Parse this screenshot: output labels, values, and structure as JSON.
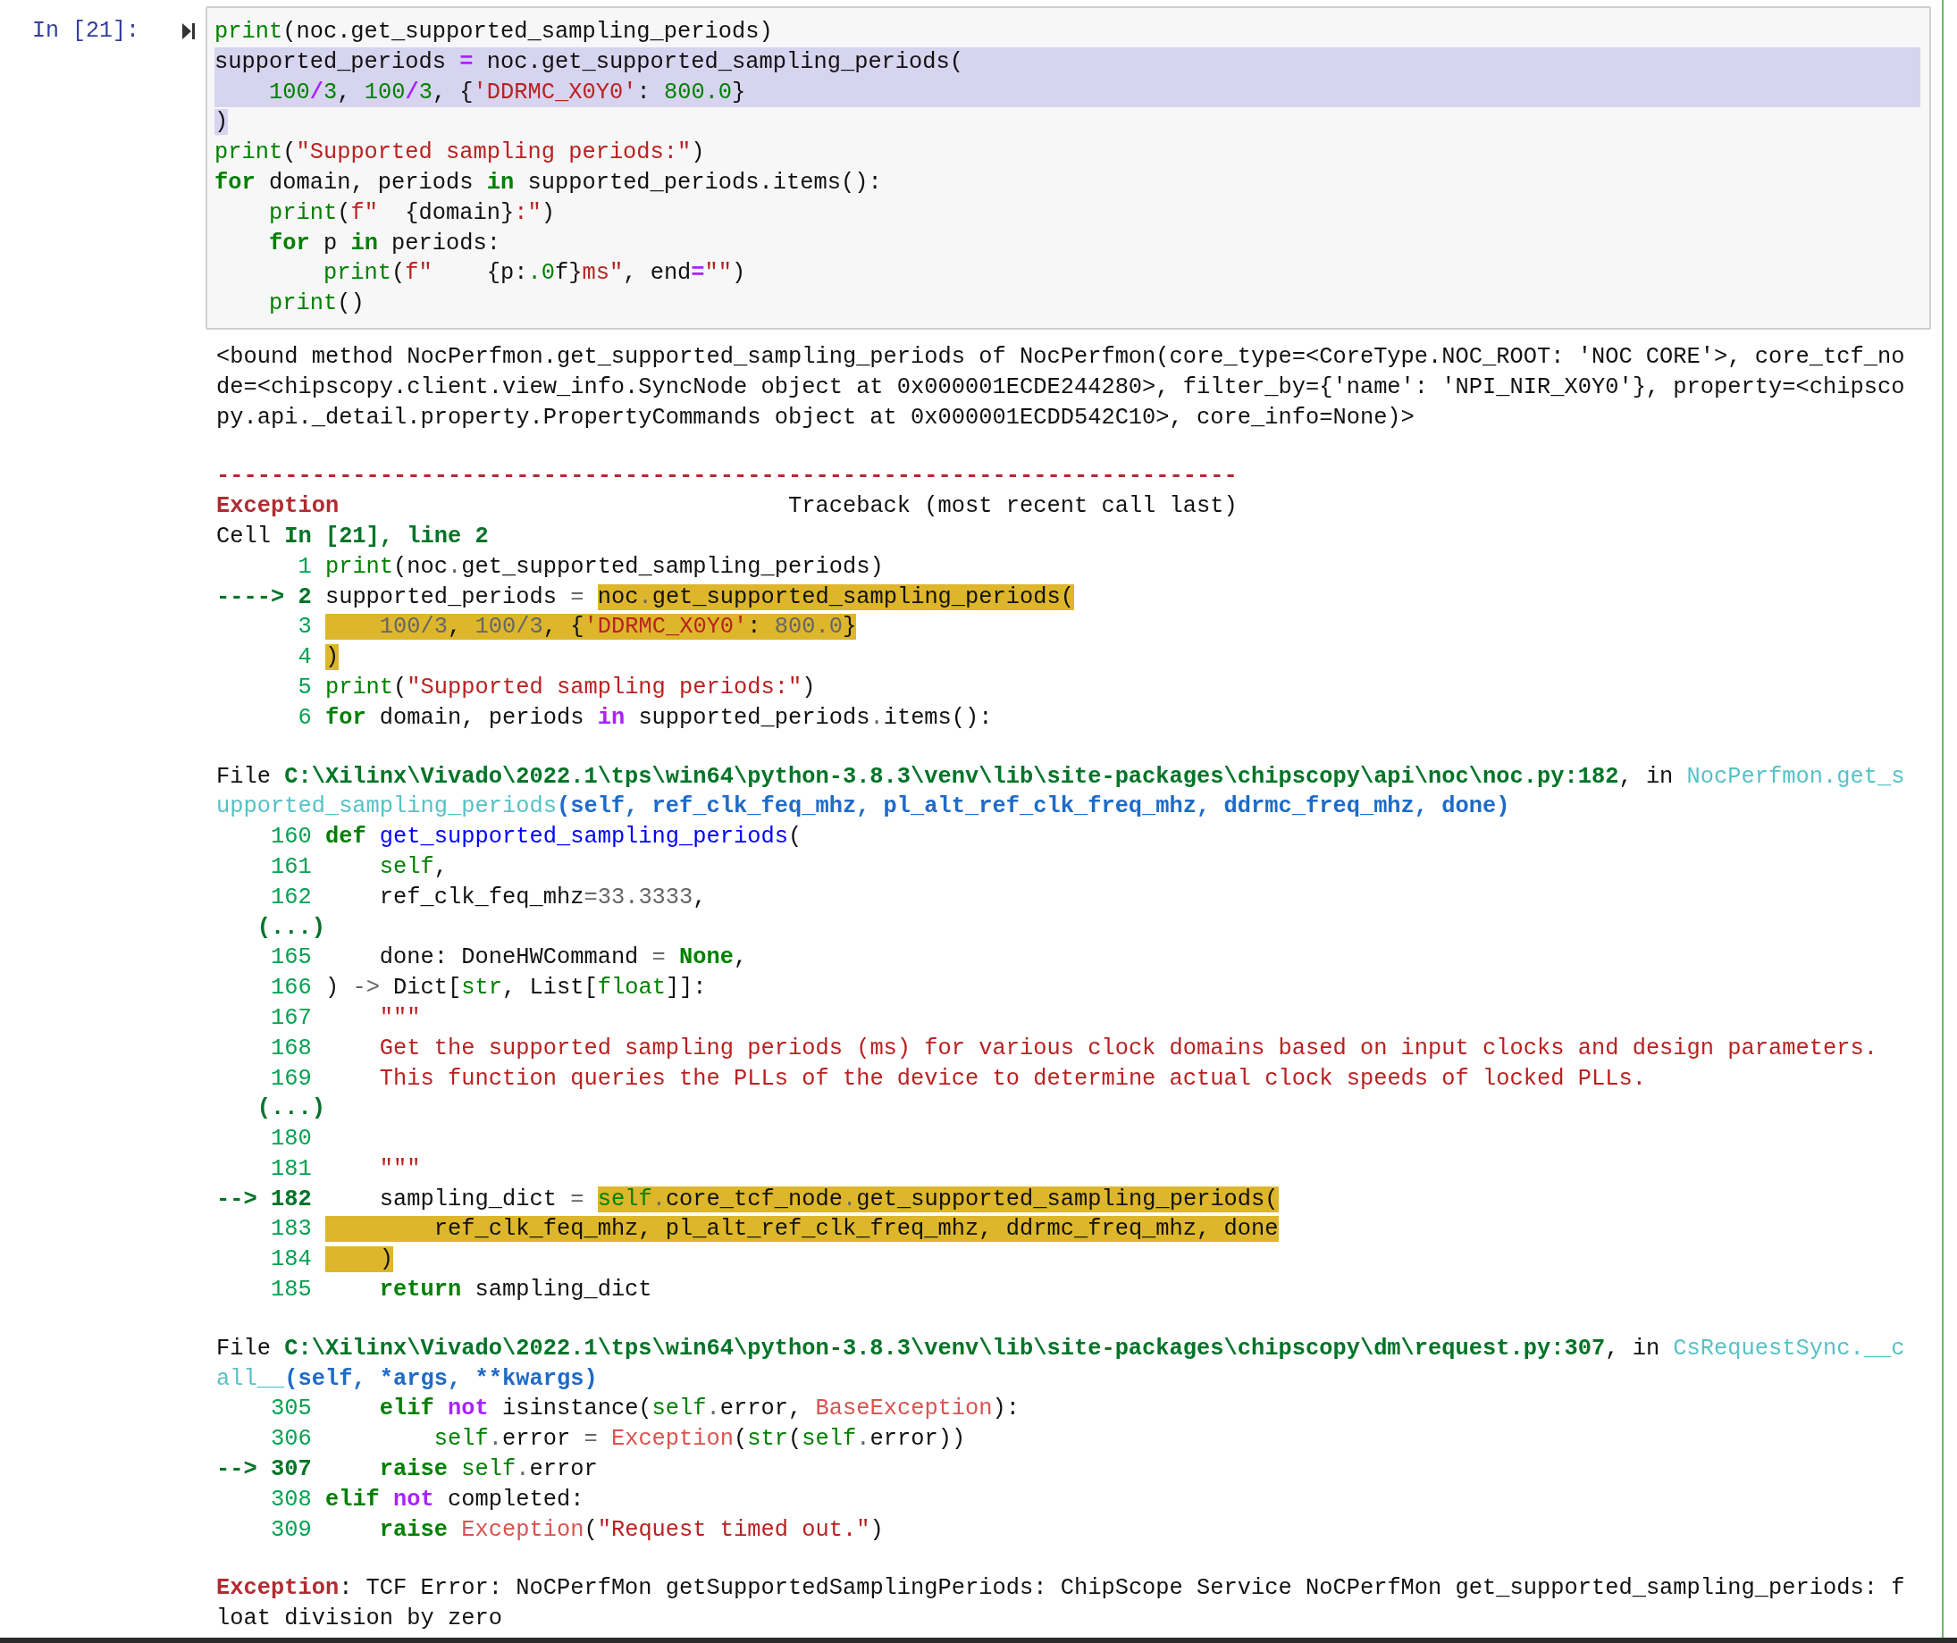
{
  "prompt": "In [21]:",
  "code": {
    "lines": [
      {
        "selected": false,
        "tokens": [
          {
            "text": "print",
            "kind": "builtin"
          },
          {
            "text": "(noc.get_supported_sampling_periods)",
            "kind": "plain"
          }
        ]
      },
      {
        "selected": true,
        "tokens": [
          {
            "text": "supported_periods ",
            "kind": "plain"
          },
          {
            "text": "=",
            "kind": "op"
          },
          {
            "text": " noc.get_supported_sampling_periods(",
            "kind": "plain"
          }
        ]
      },
      {
        "selected": true,
        "tokens": [
          {
            "text": "    100",
            "kind": "num"
          },
          {
            "text": "/",
            "kind": "op"
          },
          {
            "text": "3",
            "kind": "num"
          },
          {
            "text": ", ",
            "kind": "plain"
          },
          {
            "text": "100",
            "kind": "num"
          },
          {
            "text": "/",
            "kind": "op"
          },
          {
            "text": "3",
            "kind": "num"
          },
          {
            "text": ", {",
            "kind": "plain"
          },
          {
            "text": "'DDRMC_X0Y0'",
            "kind": "str"
          },
          {
            "text": ": ",
            "kind": "plain"
          },
          {
            "text": "800.0",
            "kind": "num"
          },
          {
            "text": "}",
            "kind": "plain"
          }
        ]
      },
      {
        "selected": false,
        "tokens": [
          {
            "text": ")",
            "kind": "plain",
            "highlighted": true
          }
        ]
      },
      {
        "selected": false,
        "tokens": [
          {
            "text": "print",
            "kind": "builtin"
          },
          {
            "text": "(",
            "kind": "plain"
          },
          {
            "text": "\"Supported sampling periods:\"",
            "kind": "str"
          },
          {
            "text": ")",
            "kind": "plain"
          }
        ]
      },
      {
        "selected": false,
        "tokens": [
          {
            "text": "for",
            "kind": "kw"
          },
          {
            "text": " domain, periods ",
            "kind": "plain"
          },
          {
            "text": "in",
            "kind": "kw"
          },
          {
            "text": " supported_periods.items():",
            "kind": "plain"
          }
        ]
      },
      {
        "selected": false,
        "tokens": [
          {
            "text": "    print",
            "kind": "builtin"
          },
          {
            "text": "(",
            "kind": "plain"
          },
          {
            "text": "f\"  ",
            "kind": "str"
          },
          {
            "text": "{domain}",
            "kind": "plain"
          },
          {
            "text": ":\"",
            "kind": "str"
          },
          {
            "text": ")",
            "kind": "plain"
          }
        ]
      },
      {
        "selected": false,
        "tokens": [
          {
            "text": "    for",
            "kind": "kw"
          },
          {
            "text": " p ",
            "kind": "plain"
          },
          {
            "text": "in",
            "kind": "kw"
          },
          {
            "text": " periods:",
            "kind": "plain"
          }
        ]
      },
      {
        "selected": false,
        "tokens": [
          {
            "text": "        print",
            "kind": "builtin"
          },
          {
            "text": "(",
            "kind": "plain"
          },
          {
            "text": "f\"    ",
            "kind": "str"
          },
          {
            "text": "{p:",
            "kind": "plain"
          },
          {
            "text": ".0",
            "kind": "num"
          },
          {
            "text": "f}",
            "kind": "plain"
          },
          {
            "text": "ms\"",
            "kind": "str"
          },
          {
            "text": ", end",
            "kind": "plain"
          },
          {
            "text": "=",
            "kind": "op"
          },
          {
            "text": "\"\"",
            "kind": "str"
          },
          {
            "text": ")",
            "kind": "plain"
          }
        ]
      },
      {
        "selected": false,
        "tokens": [
          {
            "text": "    print",
            "kind": "builtin"
          },
          {
            "text": "()",
            "kind": "plain"
          }
        ]
      }
    ]
  },
  "output": {
    "blocks": [
      {
        "lines": [
          {
            "tokens": [
              {
                "text": "<bound method NocPerfmon.get_supported_sampling_periods of NocPerfmon(core_type=<CoreType.NOC_ROOT: 'NOC CORE'>, core_tcf_no",
                "kind": "plain"
              }
            ]
          },
          {
            "tokens": [
              {
                "text": "de=<chipscopy.client.view_info.SyncNode object at 0x000001ECDE244280>, filter_by={'name': 'NPI_NIR_X0Y0'}, property=<chipsco",
                "kind": "plain"
              }
            ]
          },
          {
            "tokens": [
              {
                "text": "py.api._detail.property.PropertyCommands object at 0x000001ECDD542C10>, core_info=None)>",
                "kind": "plain"
              }
            ]
          }
        ]
      },
      {
        "lines": [
          {
            "tokens": [
              {
                "text": "---------------------------------------------------------------------------",
                "kind": "ename"
              }
            ]
          },
          {
            "tokens": [
              {
                "text": "Exception",
                "kind": "ename"
              },
              {
                "text": "                                 Traceback (most recent call last)",
                "kind": "plain"
              }
            ]
          },
          {
            "tokens": [
              {
                "text": "Cell ",
                "kind": "plain"
              },
              {
                "text": "In [21], line 2",
                "kind": "path"
              }
            ]
          },
          {
            "tokens": [
              {
                "text": "      1 ",
                "kind": "lineno"
              },
              {
                "text": "print",
                "kind": "builtin"
              },
              {
                "text": "(noc",
                "kind": "plain"
              },
              {
                "text": ".",
                "kind": "dim"
              },
              {
                "text": "get_supported_sampling_periods)",
                "kind": "plain"
              }
            ]
          },
          {
            "tokens": [
              {
                "text": "----> 2",
                "kind": "arrow",
                "highlighted": false
              },
              {
                "text": " supported_periods ",
                "kind": "plain",
                "highlighted": false
              },
              {
                "text": "= ",
                "kind": "dim",
                "highlighted": false
              },
              {
                "text": "noc",
                "kind": "plain",
                "highlighted": true
              },
              {
                "text": ".",
                "kind": "dim",
                "highlighted": true
              },
              {
                "text": "get_supported_sampling_periods(",
                "kind": "plain",
                "highlighted": true
              }
            ]
          },
          {
            "tokens": [
              {
                "text": "      3 ",
                "kind": "lineno",
                "highlighted": false
              },
              {
                "text": "    100",
                "kind": "numdim",
                "highlighted": true
              },
              {
                "text": "/",
                "kind": "dim",
                "highlighted": true
              },
              {
                "text": "3",
                "kind": "numdim",
                "highlighted": true
              },
              {
                "text": ", ",
                "kind": "plain",
                "highlighted": true
              },
              {
                "text": "100",
                "kind": "numdim",
                "highlighted": true
              },
              {
                "text": "/",
                "kind": "dim",
                "highlighted": true
              },
              {
                "text": "3",
                "kind": "numdim",
                "highlighted": true
              },
              {
                "text": ", {",
                "kind": "plain",
                "highlighted": true
              },
              {
                "text": "'DDRMC_X0Y0'",
                "kind": "str",
                "highlighted": true
              },
              {
                "text": ": ",
                "kind": "plain",
                "highlighted": true
              },
              {
                "text": "800.0",
                "kind": "numdim",
                "highlighted": true
              },
              {
                "text": "}",
                "kind": "plain",
                "highlighted": true
              }
            ]
          },
          {
            "tokens": [
              {
                "text": "      4 ",
                "kind": "lineno",
                "highlighted": false
              },
              {
                "text": ")",
                "kind": "plain",
                "highlighted": true
              }
            ]
          },
          {
            "tokens": [
              {
                "text": "      5 ",
                "kind": "lineno"
              },
              {
                "text": "print",
                "kind": "builtin"
              },
              {
                "text": "(",
                "kind": "plain"
              },
              {
                "text": "\"Supported sampling periods:\"",
                "kind": "str"
              },
              {
                "text": ")",
                "kind": "plain"
              }
            ]
          },
          {
            "tokens": [
              {
                "text": "      6 ",
                "kind": "lineno"
              },
              {
                "text": "for",
                "kind": "kw"
              },
              {
                "text": " domain, periods ",
                "kind": "plain"
              },
              {
                "text": "in",
                "kind": "opword"
              },
              {
                "text": " supported_periods",
                "kind": "plain"
              },
              {
                "text": ".",
                "kind": "dim"
              },
              {
                "text": "items():",
                "kind": "plain"
              }
            ]
          }
        ]
      },
      {
        "lines": [
          {
            "tokens": [
              {
                "text": "File ",
                "kind": "plain"
              },
              {
                "text": "C:\\Xilinx\\Vivado\\2022.1\\tps\\win64\\python-3.8.3\\venv\\lib\\site-packages\\chipscopy\\api\\noc\\noc.py:182",
                "kind": "path"
              },
              {
                "text": ", in ",
                "kind": "plain"
              },
              {
                "text": "NocPerfmon.get_s",
                "kind": "cyan"
              }
            ]
          },
          {
            "tokens": [
              {
                "text": "upported_sampling_periods",
                "kind": "cyan"
              },
              {
                "text": "(self, ref_clk_feq_mhz, pl_alt_ref_clk_freq_mhz, ddrmc_freq_mhz, done)",
                "kind": "blue"
              }
            ]
          },
          {
            "tokens": [
              {
                "text": "    160 ",
                "kind": "lineno"
              },
              {
                "text": "def ",
                "kind": "kw"
              },
              {
                "text": "get_supported_sampling_periods",
                "kind": "fname"
              },
              {
                "text": "(",
                "kind": "plain"
              }
            ]
          },
          {
            "tokens": [
              {
                "text": "    161 ",
                "kind": "lineno"
              },
              {
                "text": "    self",
                "kind": "builtin"
              },
              {
                "text": ",",
                "kind": "plain"
              }
            ]
          },
          {
            "tokens": [
              {
                "text": "    162 ",
                "kind": "lineno"
              },
              {
                "text": "    ref_clk_feq_mhz",
                "kind": "plain"
              },
              {
                "text": "=",
                "kind": "dim"
              },
              {
                "text": "33.3333",
                "kind": "numdim"
              },
              {
                "text": ",",
                "kind": "plain"
              }
            ]
          },
          {
            "tokens": [
              {
                "text": "   (...)",
                "kind": "path"
              }
            ]
          },
          {
            "tokens": [
              {
                "text": "    165 ",
                "kind": "lineno"
              },
              {
                "text": "    done: DoneHWCommand ",
                "kind": "plain"
              },
              {
                "text": "= ",
                "kind": "dim"
              },
              {
                "text": "None",
                "kind": "kw"
              },
              {
                "text": ",",
                "kind": "plain"
              }
            ]
          },
          {
            "tokens": [
              {
                "text": "    166 ",
                "kind": "lineno"
              },
              {
                "text": ") ",
                "kind": "plain"
              },
              {
                "text": "->",
                "kind": "dim"
              },
              {
                "text": " Dict[",
                "kind": "plain"
              },
              {
                "text": "str",
                "kind": "builtin"
              },
              {
                "text": ", List[",
                "kind": "plain"
              },
              {
                "text": "float",
                "kind": "builtin"
              },
              {
                "text": "]]:",
                "kind": "plain"
              }
            ]
          },
          {
            "tokens": [
              {
                "text": "    167 ",
                "kind": "lineno"
              },
              {
                "text": "    \"\"\"",
                "kind": "str"
              }
            ]
          },
          {
            "tokens": [
              {
                "text": "    168 ",
                "kind": "lineno"
              },
              {
                "text": "    Get the supported sampling periods (ms) for various clock domains based on input clocks and design parameters.",
                "kind": "str"
              }
            ]
          },
          {
            "tokens": [
              {
                "text": "    169 ",
                "kind": "lineno"
              },
              {
                "text": "    This function queries the PLLs of the device to determine actual clock speeds of locked PLLs.",
                "kind": "str"
              }
            ]
          },
          {
            "tokens": [
              {
                "text": "   (...)",
                "kind": "path"
              }
            ]
          },
          {
            "tokens": [
              {
                "text": "    180",
                "kind": "lineno"
              }
            ]
          },
          {
            "tokens": [
              {
                "text": "    181 ",
                "kind": "lineno"
              },
              {
                "text": "    \"\"\"",
                "kind": "str"
              }
            ]
          },
          {
            "tokens": [
              {
                "text": "--> 182",
                "kind": "arrow",
                "highlighted": false
              },
              {
                "text": "     sampling_dict ",
                "kind": "plain",
                "highlighted": false
              },
              {
                "text": "= ",
                "kind": "dim",
                "highlighted": false
              },
              {
                "text": "self",
                "kind": "builtin",
                "highlighted": true
              },
              {
                "text": ".",
                "kind": "dim",
                "highlighted": true
              },
              {
                "text": "core_tcf_node",
                "kind": "plain",
                "highlighted": true
              },
              {
                "text": ".",
                "kind": "dim",
                "highlighted": true
              },
              {
                "text": "get_supported_sampling_periods(",
                "kind": "plain",
                "highlighted": true
              }
            ]
          },
          {
            "tokens": [
              {
                "text": "    183 ",
                "kind": "lineno",
                "highlighted": false
              },
              {
                "text": "        ref_clk_feq_mhz, pl_alt_ref_clk_freq_mhz, ddrmc_freq_mhz, done",
                "kind": "plain",
                "highlighted": true
              }
            ]
          },
          {
            "tokens": [
              {
                "text": "    184 ",
                "kind": "lineno",
                "highlighted": false
              },
              {
                "text": "    )",
                "kind": "plain",
                "highlighted": true
              }
            ]
          },
          {
            "tokens": [
              {
                "text": "    185 ",
                "kind": "lineno"
              },
              {
                "text": "    return",
                "kind": "kw"
              },
              {
                "text": " sampling_dict",
                "kind": "plain"
              }
            ]
          }
        ]
      },
      {
        "lines": [
          {
            "tokens": [
              {
                "text": "File ",
                "kind": "plain"
              },
              {
                "text": "C:\\Xilinx\\Vivado\\2022.1\\tps\\win64\\python-3.8.3\\venv\\lib\\site-packages\\chipscopy\\dm\\request.py:307",
                "kind": "path"
              },
              {
                "text": ", in ",
                "kind": "plain"
              },
              {
                "text": "CsRequestSync.__c",
                "kind": "cyan"
              }
            ]
          },
          {
            "tokens": [
              {
                "text": "all__",
                "kind": "cyan"
              },
              {
                "text": "(self, *args, **kwargs)",
                "kind": "blue"
              }
            ]
          },
          {
            "tokens": [
              {
                "text": "    305 ",
                "kind": "lineno"
              },
              {
                "text": "    elif ",
                "kind": "kw"
              },
              {
                "text": "not",
                "kind": "opword"
              },
              {
                "text": " isinstance(",
                "kind": "plain"
              },
              {
                "text": "self",
                "kind": "builtin"
              },
              {
                "text": ".",
                "kind": "dim"
              },
              {
                "text": "error, ",
                "kind": "plain"
              },
              {
                "text": "BaseException",
                "kind": "exc"
              },
              {
                "text": "):",
                "kind": "plain"
              }
            ]
          },
          {
            "tokens": [
              {
                "text": "    306 ",
                "kind": "lineno"
              },
              {
                "text": "        self",
                "kind": "builtin"
              },
              {
                "text": ".",
                "kind": "dim"
              },
              {
                "text": "error ",
                "kind": "plain"
              },
              {
                "text": "= ",
                "kind": "dim"
              },
              {
                "text": "Exception",
                "kind": "exc"
              },
              {
                "text": "(",
                "kind": "plain"
              },
              {
                "text": "str",
                "kind": "builtin"
              },
              {
                "text": "(",
                "kind": "plain"
              },
              {
                "text": "self",
                "kind": "builtin"
              },
              {
                "text": ".",
                "kind": "dim"
              },
              {
                "text": "error))",
                "kind": "plain"
              }
            ]
          },
          {
            "tokens": [
              {
                "text": "--> 307",
                "kind": "arrow"
              },
              {
                "text": "     raise ",
                "kind": "kw"
              },
              {
                "text": "self",
                "kind": "builtin"
              },
              {
                "text": ".",
                "kind": "dim"
              },
              {
                "text": "error",
                "kind": "plain"
              }
            ]
          },
          {
            "tokens": [
              {
                "text": "    308 ",
                "kind": "lineno"
              },
              {
                "text": "elif ",
                "kind": "kw"
              },
              {
                "text": "not",
                "kind": "opword"
              },
              {
                "text": " completed:",
                "kind": "plain"
              }
            ]
          },
          {
            "tokens": [
              {
                "text": "    309 ",
                "kind": "lineno"
              },
              {
                "text": "    raise ",
                "kind": "kw"
              },
              {
                "text": "Exception",
                "kind": "exc"
              },
              {
                "text": "(",
                "kind": "plain"
              },
              {
                "text": "\"Request timed out.\"",
                "kind": "str"
              },
              {
                "text": ")",
                "kind": "plain"
              }
            ]
          }
        ]
      },
      {
        "lines": [
          {
            "tokens": [
              {
                "text": "Exception",
                "kind": "ename"
              },
              {
                "text": ": TCF Error: NoCPerfMon getSupportedSamplingPeriods: ChipScope Service NoCPerfMon get_supported_sampling_periods: f",
                "kind": "plain"
              }
            ]
          },
          {
            "tokens": [
              {
                "text": "loat division by zero",
                "kind": "plain"
              }
            ]
          }
        ]
      }
    ]
  }
}
